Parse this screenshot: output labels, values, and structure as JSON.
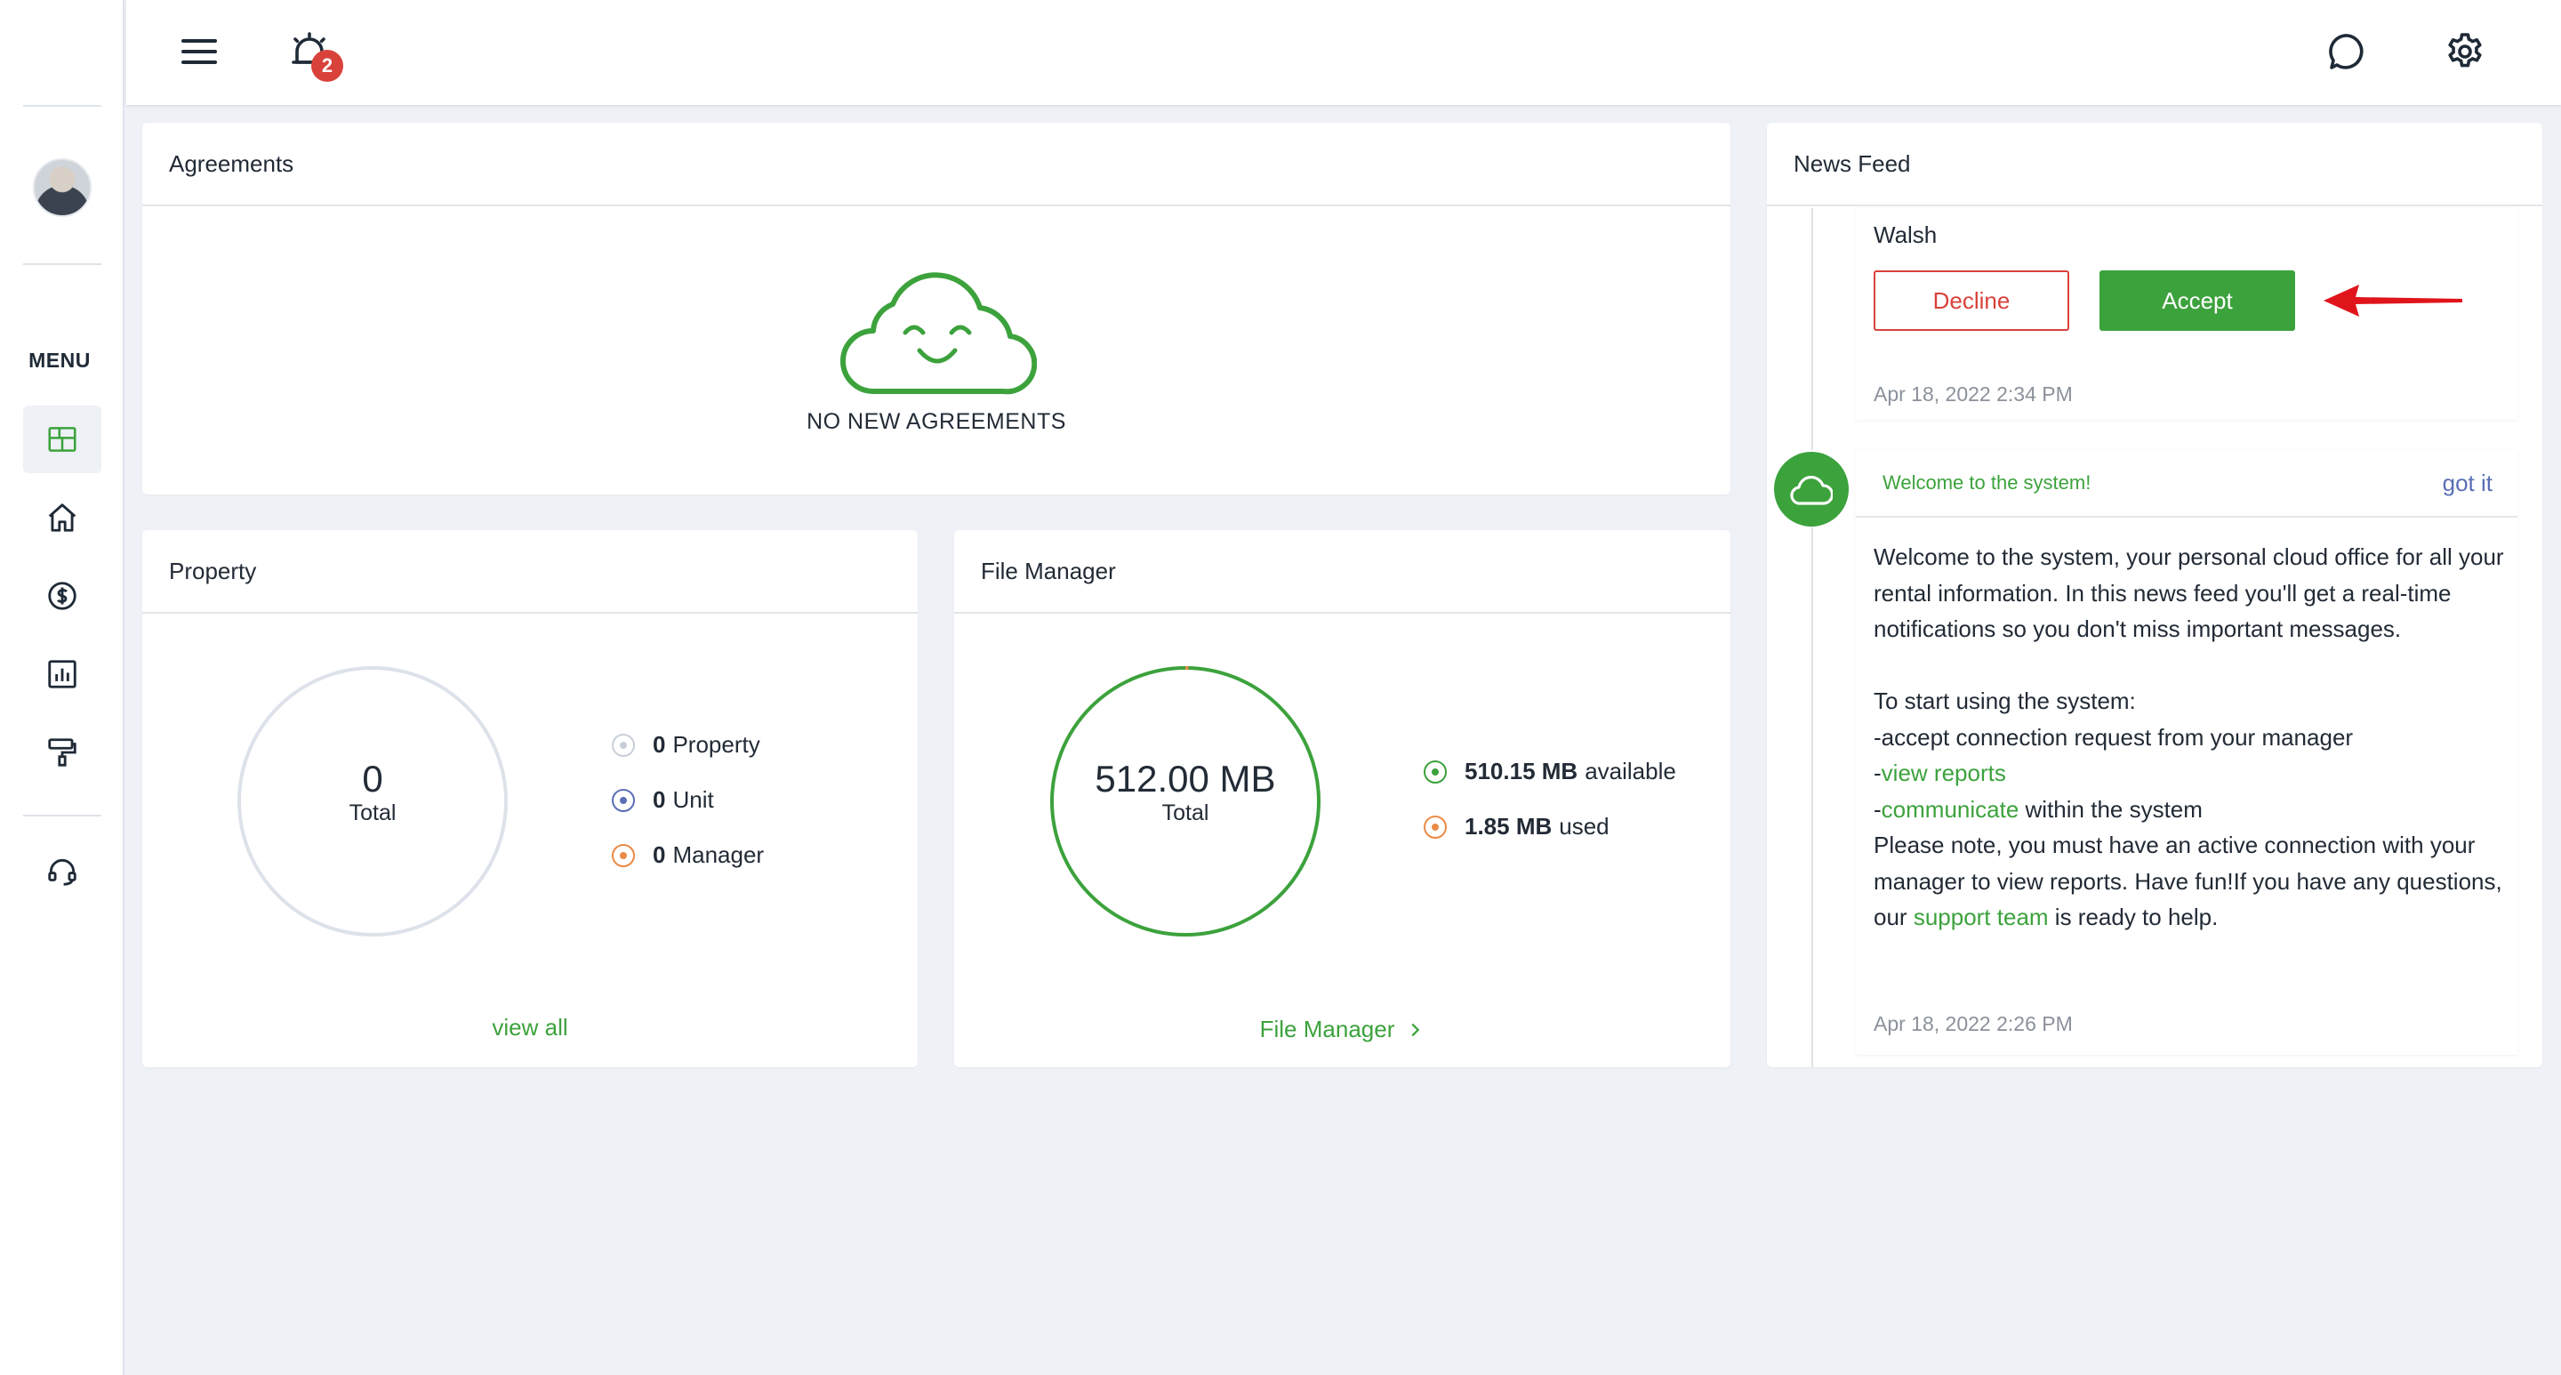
{
  "sidebar": {
    "menu_label": "MENU",
    "items": [
      {
        "icon": "dashboard-icon",
        "active": true
      },
      {
        "icon": "home-icon"
      },
      {
        "icon": "dollar-icon"
      },
      {
        "icon": "reports-icon"
      },
      {
        "icon": "paint-roller-icon"
      },
      {
        "icon": "support-headset-icon"
      }
    ]
  },
  "topbar": {
    "notification_count": "2"
  },
  "agreements": {
    "title": "Agreements",
    "empty_text": "NO NEW AGREEMENTS"
  },
  "property": {
    "title": "Property",
    "total_value": "0",
    "total_label": "Total",
    "legend": [
      {
        "value": "0",
        "label": "Property",
        "color": "#c9cfd8"
      },
      {
        "value": "0",
        "label": "Unit",
        "color": "#5a6fb5"
      },
      {
        "value": "0",
        "label": "Manager",
        "color": "#ea8a45"
      }
    ],
    "link": "view all"
  },
  "file_manager": {
    "title": "File Manager",
    "total_value": "512.00 MB",
    "total_label": "Total",
    "used_fraction": 0.0036,
    "legend": [
      {
        "value": "510.15 MB",
        "label": "available",
        "color": "#3ca23c"
      },
      {
        "value": "1.85 MB",
        "label": "used",
        "color": "#ea8a45"
      }
    ],
    "link": "File Manager"
  },
  "news_feed": {
    "title": "News Feed",
    "request": {
      "name_fragment": "Walsh",
      "decline_label": "Decline",
      "accept_label": "Accept",
      "date": "Apr 18, 2022 2:34 PM"
    },
    "welcome": {
      "title": "Welcome to the system!",
      "dismiss": "got it",
      "intro": "Welcome to the system, your personal cloud office for all your rental information. In this news feed you'll get a real-time notifications so you don't miss important messages.",
      "start": "To start using the system:",
      "step1": "-accept connection request from your manager",
      "step2_dash": "-",
      "step2_link": "view reports",
      "step3_dash": "-",
      "step3_link": "communicate",
      "step3_rest": " within the system",
      "note": "Please note, you must have an active connection with your manager to view reports. Have fun!If you have any questions, our ",
      "note_link": "support team",
      "note_end": " is ready to help.",
      "date": "Apr 18, 2022 2:26 PM"
    }
  },
  "colors": {
    "accent": "#3ca23c",
    "danger": "#d9413b",
    "link_blue": "#5a6fb5"
  }
}
